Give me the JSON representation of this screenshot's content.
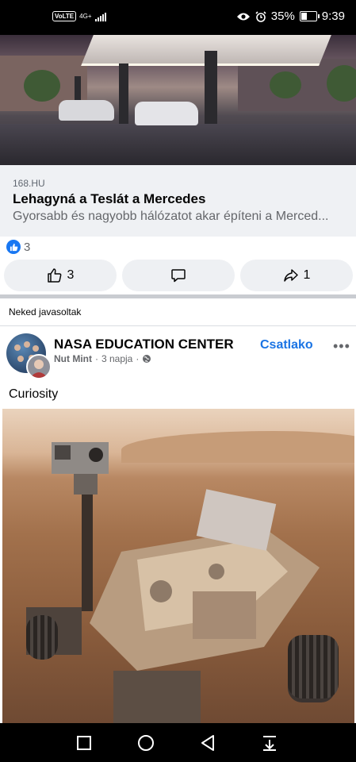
{
  "status_bar": {
    "volte": "VoLTE",
    "network": "4G+",
    "battery_percent": "35%",
    "battery_level": 0.35,
    "time": "9:39",
    "icons": [
      "eye-icon",
      "alarm-icon",
      "battery-icon",
      "signal-icon"
    ]
  },
  "link_preview": {
    "domain": "168.HU",
    "title": "Lehagyná a Teslát a Mercedes",
    "description": "Gyorsabb és nagyobb hálózatot akar építeni a Merced..."
  },
  "post_stats": {
    "reaction_count": "3"
  },
  "actions": {
    "like_count": "3",
    "share_count": "1"
  },
  "feed": {
    "section_label": "Neked javasoltak"
  },
  "suggested_post": {
    "page_name": "NASA EDUCATION CENTER",
    "author": "Nut Mint",
    "separator": "·",
    "time": "3 napja",
    "join_label": "Csatlako",
    "more": "•••",
    "text": "Curiosity"
  },
  "colors": {
    "accent": "#1b74e4",
    "like_blue": "#1877f2",
    "muted_text": "#65676b"
  }
}
